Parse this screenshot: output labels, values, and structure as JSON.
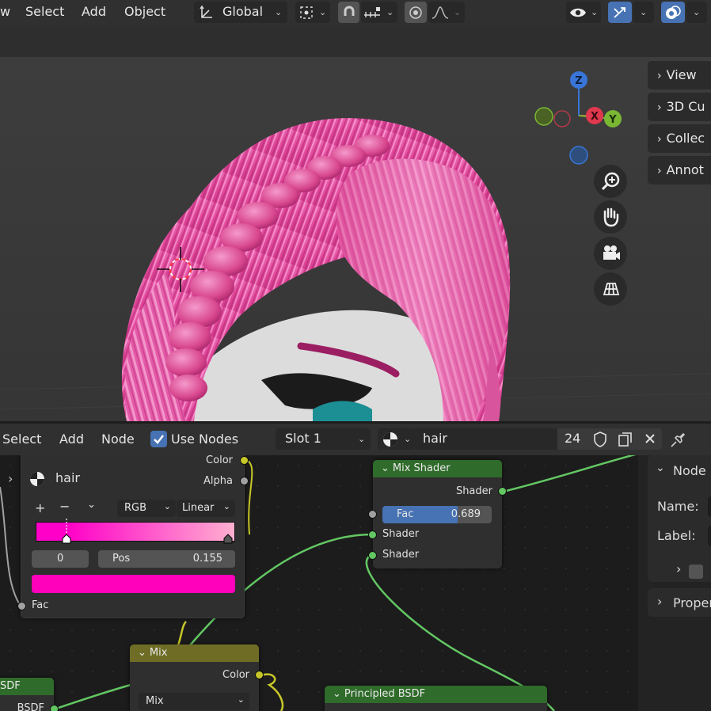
{
  "header": {
    "menu": [
      "w",
      "Select",
      "Add",
      "Object"
    ],
    "orientation": "Global"
  },
  "viewport": {
    "tabs": [
      "View",
      "3D Cu",
      "Collec",
      "Annot"
    ],
    "gizmo": {
      "z": "Z",
      "x": "X",
      "y": "Y"
    },
    "nav_icons": [
      "zoom-icon",
      "hand-icon",
      "camera-icon",
      "grid-icon"
    ]
  },
  "node_header": {
    "menu": [
      "Select",
      "Add",
      "Node"
    ],
    "use_nodes": "Use Nodes",
    "slot": "Slot 1",
    "material_name": "hair",
    "users": "24"
  },
  "nodes": {
    "color_ramp": {
      "name": "hair",
      "out_color": "Color",
      "out_alpha": "Alpha",
      "mode": "RGB",
      "interp": "Linear",
      "stop_index": "0",
      "pos_label": "Pos",
      "pos_value": "0.155",
      "fac": "Fac",
      "ramp_left": "#ff00c8",
      "ramp_right": "#ffb0d0",
      "selected_color": "#ff00bb"
    },
    "mix_shader": {
      "title": "Mix Shader",
      "out_shader": "Shader",
      "fac_label": "Fac",
      "fac_value": "0.689",
      "fac_fraction": 0.689,
      "in_shader1": "Shader",
      "in_shader2": "Shader"
    },
    "mix": {
      "title": "Mix",
      "out_color": "Color",
      "blend": "Mix"
    },
    "principled": {
      "title": "Principled BSDF"
    },
    "bsdf_left": {
      "title": "SDF",
      "socket": "BSDF"
    }
  },
  "sidebar": {
    "panel_node": "Node",
    "name_label": "Name:",
    "label_label": "Label:",
    "properties": "Proper"
  },
  "colors": {
    "accent": "#4772b3",
    "shader_header": "#2f6b2a",
    "color_header": "#6f6c26",
    "hair": "#e0479a"
  }
}
